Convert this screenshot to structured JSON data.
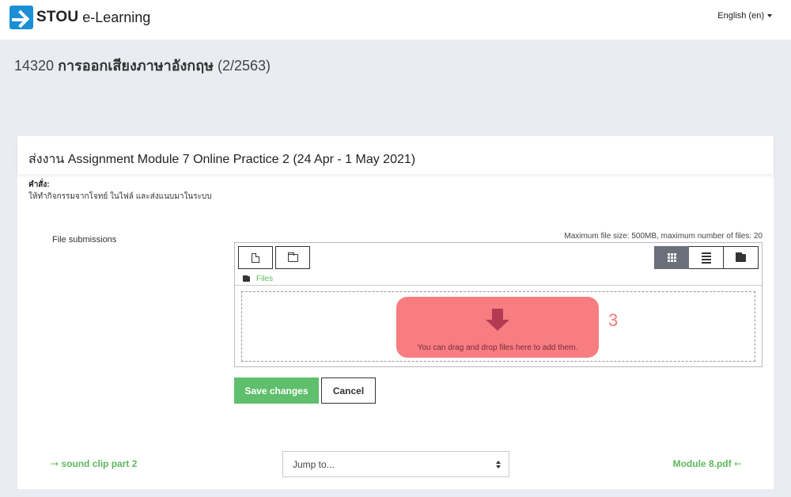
{
  "header": {
    "brand_strong": "STOU",
    "brand_light": "e-Learning",
    "language": "English (en)"
  },
  "course": {
    "code": "14320",
    "name_th": "การออกเสียงภาษาอังกฤษ",
    "term": "(2/2563)"
  },
  "assignment": {
    "title": "ส่งงาน Assignment Module 7 Online Practice 2 (24 Apr - 1 May 2021)",
    "instruction_label": "คำสั่ง:",
    "instruction_text": "ให้ทำกิจกรรมจากโจทย์ ในไฟล์ และส่งแนบมาในระบบ"
  },
  "submission": {
    "label": "File submissions",
    "max_info": "Maximum file size: 500MB, maximum number of files: 20",
    "path_label": "Files",
    "drop_text": "You can drag and drop files here to add them.",
    "annotation_number": "3"
  },
  "actions": {
    "save": "Save changes",
    "cancel": "Cancel"
  },
  "navigation": {
    "prev": "⇾ sound clip part 2",
    "jump": "Jump to...",
    "next": "Module 8.pdf ⇽"
  },
  "colors": {
    "accent_green": "#5cb85c",
    "highlight": "#f77d80",
    "logo_blue": "#1a8fd6"
  }
}
